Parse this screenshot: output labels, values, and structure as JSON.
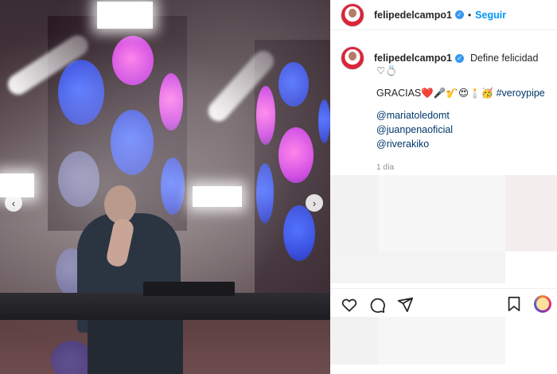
{
  "post": {
    "author": "felipedelcampo1",
    "follow_label": "Seguir",
    "caption_title": "Define felicidad",
    "caption_emojis_1": "♡💍",
    "caption_line": "GRACIAS❤️🎤🎷😍🕯️🥳",
    "hashtag": "#veroypipe",
    "mentions": [
      "@mariatoledomt",
      "@juanpenaoficial",
      "@riverakiko"
    ],
    "time": "1 día"
  },
  "colors": {
    "link": "#0095f6",
    "mention": "#00376b",
    "muted": "#8e8e8e"
  },
  "icons": {
    "like": "heart-icon",
    "comment": "comment-icon",
    "share": "send-icon",
    "save": "bookmark-icon"
  }
}
